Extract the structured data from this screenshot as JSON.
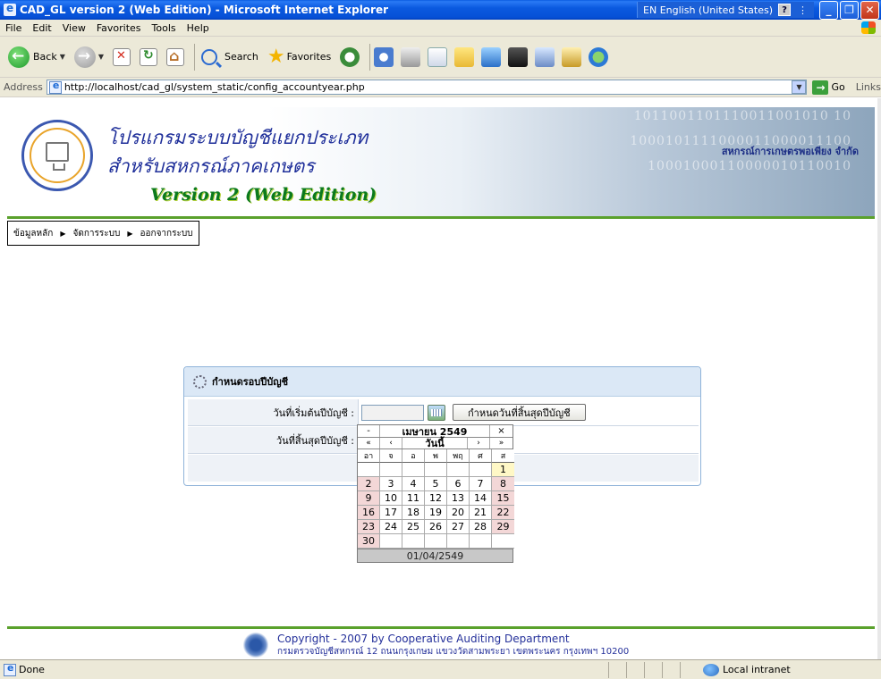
{
  "window": {
    "title": "CAD_GL version 2 (Web Edition) - Microsoft Internet Explorer",
    "language": "EN English (United States)"
  },
  "menu": [
    "File",
    "Edit",
    "View",
    "Favorites",
    "Tools",
    "Help"
  ],
  "toolbar": {
    "back_label": "Back",
    "search_label": "Search",
    "favorites_label": "Favorites"
  },
  "address": {
    "label": "Address",
    "url": "http://localhost/cad_gl/system_static/config_accountyear.php",
    "go_label": "Go",
    "links_label": "Links"
  },
  "banner": {
    "title_line1": "โปรแกรมระบบบัญชีแยกประเภท",
    "title_line2": "สำหรับสหกรณ์ภาคเกษตร",
    "version": "Version 2 (Web Edition)",
    "organization": "สหกรณ์การเกษตรพอเพียง จำกัด",
    "binary_line1": "1011001101110011001010 10",
    "binary_line2": "1000101111000011000011100",
    "binary_line3": "10001000110000010110010"
  },
  "nav": {
    "items": [
      "ข้อมูลหลัก",
      "จัดการระบบ",
      "ออกจากระบบ"
    ]
  },
  "panel": {
    "title": "กำหนดรอบปีบัญชี",
    "start_label": "วันที่เริ่มต้นปีบัญชี :",
    "end_label": "วันที่สิ้นสุดปีบัญชี :",
    "start_value": "",
    "set_end_button": "กำหนดวันที่สิ้นสุดปีบัญชี"
  },
  "calendar": {
    "minus": "-",
    "month_title": "เมษายน 2549",
    "close": "×",
    "prev_year": "«",
    "prev_month": "‹",
    "today": "วันนี้",
    "next_month": "›",
    "next_year": "»",
    "weekdays": [
      "อา",
      "จ",
      "อ",
      "พ",
      "พฤ",
      "ศ",
      "ส"
    ],
    "weeks": [
      [
        "",
        "",
        "",
        "",
        "",
        "",
        "1"
      ],
      [
        "2",
        "3",
        "4",
        "5",
        "6",
        "7",
        "8"
      ],
      [
        "9",
        "10",
        "11",
        "12",
        "13",
        "14",
        "15"
      ],
      [
        "16",
        "17",
        "18",
        "19",
        "20",
        "21",
        "22"
      ],
      [
        "23",
        "24",
        "25",
        "26",
        "27",
        "28",
        "29"
      ],
      [
        "30",
        "",
        "",
        "",
        "",
        "",
        ""
      ]
    ],
    "selected_date": "01/04/2549"
  },
  "footer": {
    "copyright": "Copyright - 2007 by Cooperative Auditing Department",
    "address": "กรมตรวจบัญชีสหกรณ์ 12 ถนนกรุงเกษม แขวงวัดสามพระยา เขตพระนคร กรุงเทพฯ 10200"
  },
  "status": {
    "text": "Done",
    "zone": "Local intranet"
  }
}
